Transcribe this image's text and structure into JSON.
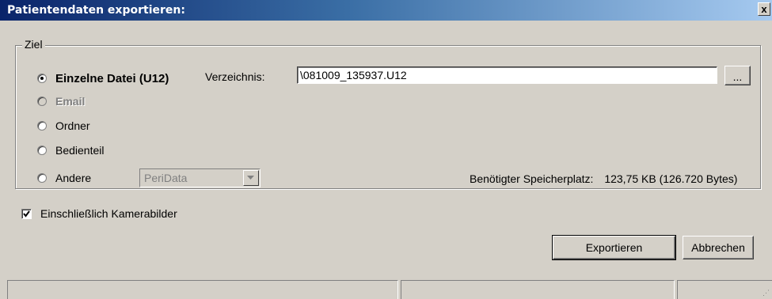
{
  "window": {
    "title": "Patientendaten exportieren:",
    "close_label": "x"
  },
  "group": {
    "label": "Ziel",
    "options": [
      {
        "label": "Einzelne Datei (U12)",
        "checked": true,
        "enabled": true
      },
      {
        "label": "Email",
        "checked": false,
        "enabled": false
      },
      {
        "label": "Ordner",
        "checked": false,
        "enabled": true
      },
      {
        "label": "Bedienteil",
        "checked": false,
        "enabled": true
      },
      {
        "label": "Andere",
        "checked": false,
        "enabled": true
      }
    ],
    "directory_label": "Verzeichnis:",
    "directory_value": "\\081009_135937.U12",
    "browse_label": "...",
    "other_select_value": "PeriData",
    "storage_label": "Benötigter Speicherplatz:",
    "storage_value": "123,75 KB (126.720 Bytes)"
  },
  "include_camera": {
    "label": "Einschließlich Kamerabilder",
    "checked": true
  },
  "buttons": {
    "export_label": "Exportieren",
    "cancel_label": "Abbrechen"
  },
  "icons": {
    "combo_arrow": "chevron-down-icon",
    "checkmark": "checkmark-icon",
    "grip": "resize-grip-icon"
  },
  "colors": {
    "titlebar_start": "#0a246a",
    "titlebar_end": "#a6caf0",
    "dialog_bg": "#d4d0c8"
  }
}
